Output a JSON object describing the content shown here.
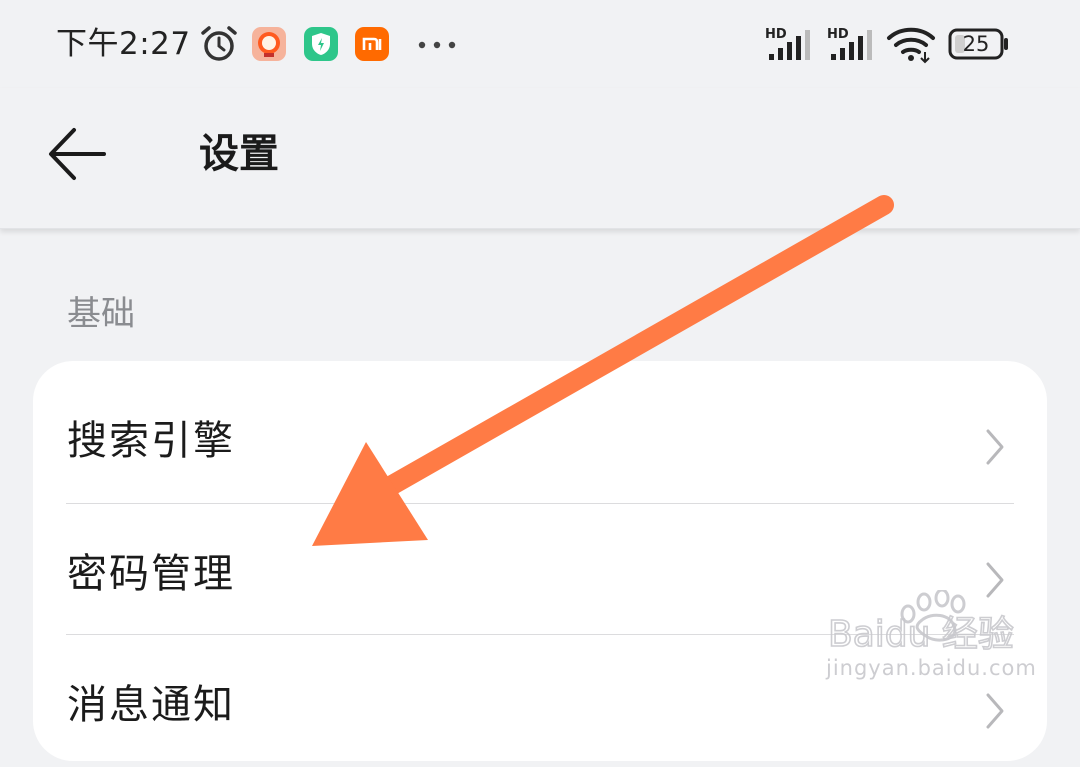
{
  "status_bar": {
    "time": "下午2:27",
    "battery": "25",
    "signal_1_label": "HD",
    "signal_2_label": "HD",
    "icons": [
      "alarm-icon",
      "taobao-app-icon",
      "shield-app-icon",
      "mi-app-icon",
      "more-dots-icon",
      "signal-icon",
      "wifi-icon",
      "battery-icon"
    ]
  },
  "header": {
    "title": "设置",
    "back_icon": "back-arrow-icon"
  },
  "section": {
    "label": "基础",
    "items": [
      {
        "label": "搜索引擎"
      },
      {
        "label": "密码管理"
      },
      {
        "label": "消息通知"
      }
    ]
  },
  "annotation": {
    "arrow_color": "#ff7b45"
  },
  "watermark": {
    "brand": "Baidu 经验",
    "url": "jingyan.baidu.com"
  }
}
